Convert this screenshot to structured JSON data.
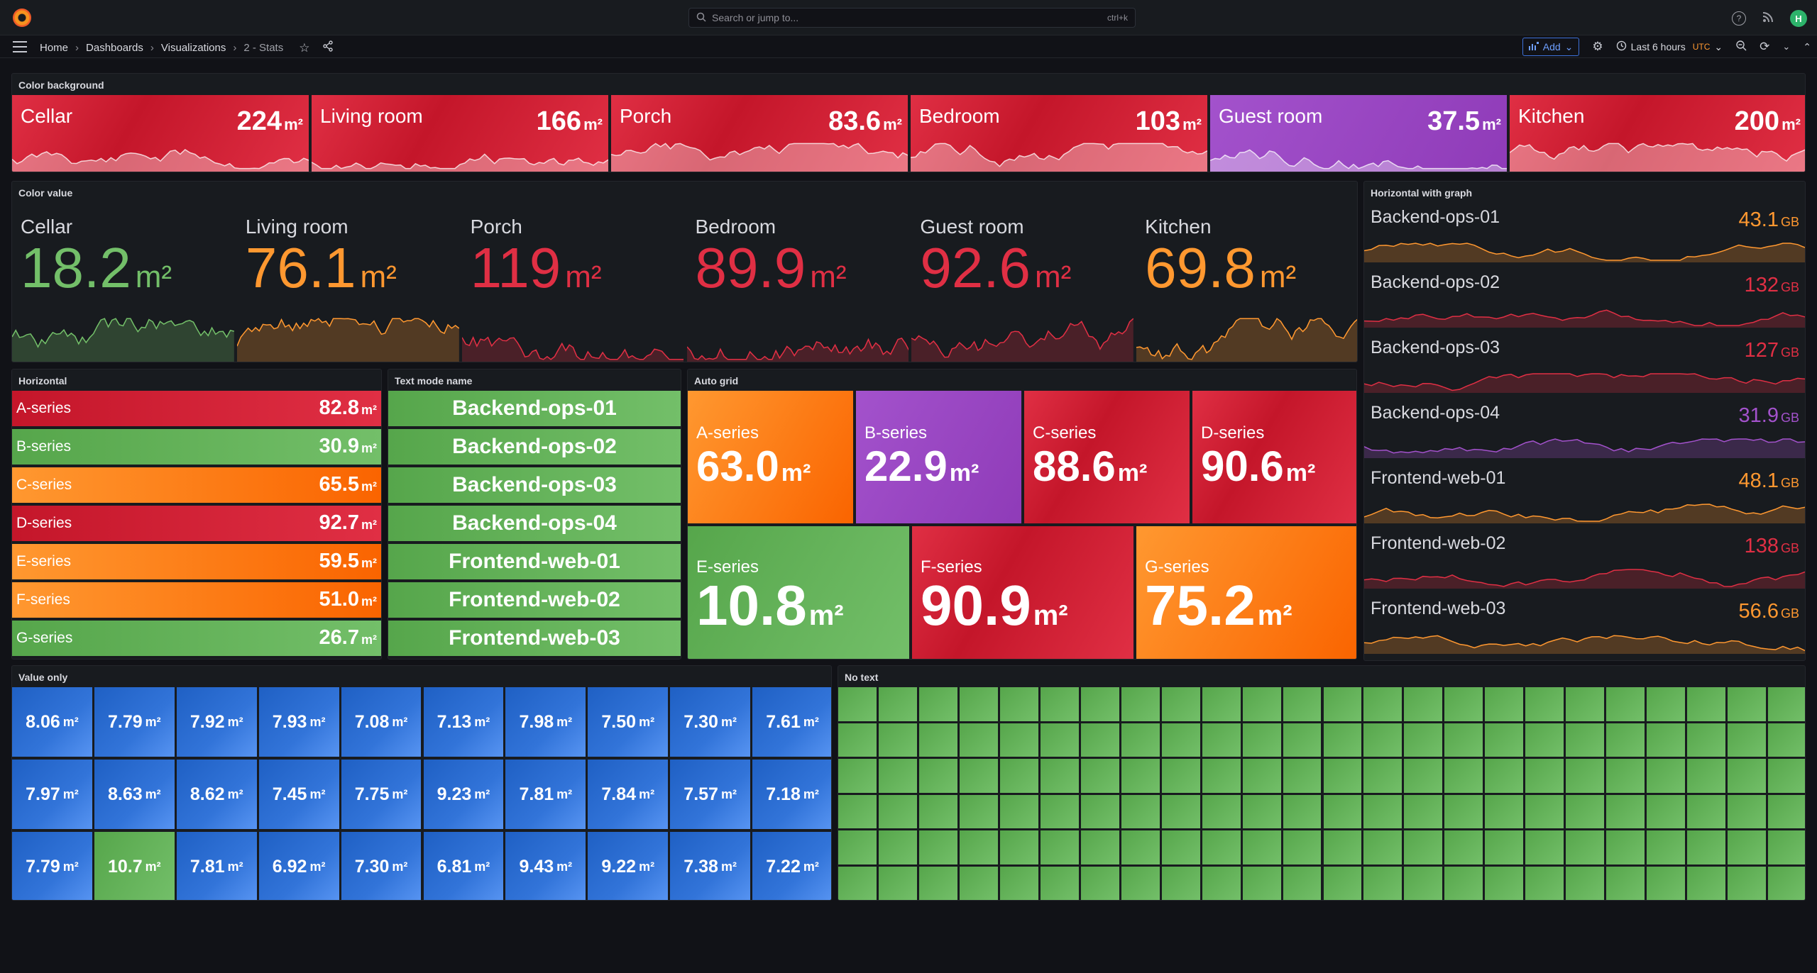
{
  "header": {
    "search_placeholder": "Search or jump to...",
    "search_shortcut": "ctrl+k",
    "avatar_initial": "H"
  },
  "breadcrumbs": [
    "Home",
    "Dashboards",
    "Visualizations",
    "2 - Stats"
  ],
  "toolbar": {
    "add_label": "Add",
    "time_range": "Last 6 hours",
    "timezone": "UTC"
  },
  "colors": {
    "red": "#e02f44",
    "orange": "#ff9830",
    "green": "#73bf69",
    "purple": "#a352cc",
    "blue": "#3274d9"
  },
  "panels": {
    "color_background": {
      "title": "Color background",
      "unit": "m²",
      "items": [
        {
          "name": "Cellar",
          "value": "224",
          "color": "red"
        },
        {
          "name": "Living room",
          "value": "166",
          "color": "red"
        },
        {
          "name": "Porch",
          "value": "83.6",
          "color": "red"
        },
        {
          "name": "Bedroom",
          "value": "103",
          "color": "red"
        },
        {
          "name": "Guest room",
          "value": "37.5",
          "color": "purple"
        },
        {
          "name": "Kitchen",
          "value": "200",
          "color": "red"
        }
      ]
    },
    "color_value": {
      "title": "Color value",
      "unit": "m²",
      "items": [
        {
          "name": "Cellar",
          "value": "18.2",
          "color": "green"
        },
        {
          "name": "Living room",
          "value": "76.1",
          "color": "orange"
        },
        {
          "name": "Porch",
          "value": "119",
          "color": "red"
        },
        {
          "name": "Bedroom",
          "value": "89.9",
          "color": "red"
        },
        {
          "name": "Guest room",
          "value": "92.6",
          "color": "red"
        },
        {
          "name": "Kitchen",
          "value": "69.8",
          "color": "orange"
        }
      ]
    },
    "horizontal_graph": {
      "title": "Horizontal with graph",
      "unit": "GB",
      "items": [
        {
          "name": "Backend-ops-01",
          "value": "43.1",
          "color": "orange"
        },
        {
          "name": "Backend-ops-02",
          "value": "132",
          "color": "red"
        },
        {
          "name": "Backend-ops-03",
          "value": "127",
          "color": "red"
        },
        {
          "name": "Backend-ops-04",
          "value": "31.9",
          "color": "purple"
        },
        {
          "name": "Frontend-web-01",
          "value": "48.1",
          "color": "orange"
        },
        {
          "name": "Frontend-web-02",
          "value": "138",
          "color": "red"
        },
        {
          "name": "Frontend-web-03",
          "value": "56.6",
          "color": "orange"
        }
      ]
    },
    "horizontal": {
      "title": "Horizontal",
      "unit": "m²",
      "items": [
        {
          "name": "A-series",
          "value": "82.8",
          "color": "red"
        },
        {
          "name": "B-series",
          "value": "30.9",
          "color": "green"
        },
        {
          "name": "C-series",
          "value": "65.5",
          "color": "orange"
        },
        {
          "name": "D-series",
          "value": "92.7",
          "color": "red"
        },
        {
          "name": "E-series",
          "value": "59.5",
          "color": "orange"
        },
        {
          "name": "F-series",
          "value": "51.0",
          "color": "orange"
        },
        {
          "name": "G-series",
          "value": "26.7",
          "color": "green"
        }
      ]
    },
    "text_mode_name": {
      "title": "Text mode name",
      "items": [
        "Backend-ops-01",
        "Backend-ops-02",
        "Backend-ops-03",
        "Backend-ops-04",
        "Frontend-web-01",
        "Frontend-web-02",
        "Frontend-web-03"
      ]
    },
    "auto_grid": {
      "title": "Auto grid",
      "unit": "m²",
      "items": [
        {
          "name": "A-series",
          "value": "63.0",
          "color": "orange"
        },
        {
          "name": "B-series",
          "value": "22.9",
          "color": "purple"
        },
        {
          "name": "C-series",
          "value": "88.6",
          "color": "red"
        },
        {
          "name": "D-series",
          "value": "90.6",
          "color": "red"
        },
        {
          "name": "E-series",
          "value": "10.8",
          "color": "green"
        },
        {
          "name": "F-series",
          "value": "90.9",
          "color": "red"
        },
        {
          "name": "G-series",
          "value": "75.2",
          "color": "orange"
        }
      ]
    },
    "value_only": {
      "title": "Value only",
      "unit": "m²",
      "values": [
        "8.06",
        "7.79",
        "7.92",
        "7.93",
        "7.08",
        "7.13",
        "7.98",
        "7.50",
        "7.30",
        "7.61",
        "7.97",
        "8.63",
        "8.62",
        "7.45",
        "7.75",
        "9.23",
        "7.81",
        "7.84",
        "7.57",
        "7.18",
        "7.79",
        "10.7",
        "7.81",
        "6.92",
        "7.30",
        "6.81",
        "9.43",
        "9.22",
        "7.38",
        "7.22"
      ],
      "green_index": 21
    },
    "no_text": {
      "title": "No text",
      "columns": 24,
      "rows": 6
    }
  }
}
